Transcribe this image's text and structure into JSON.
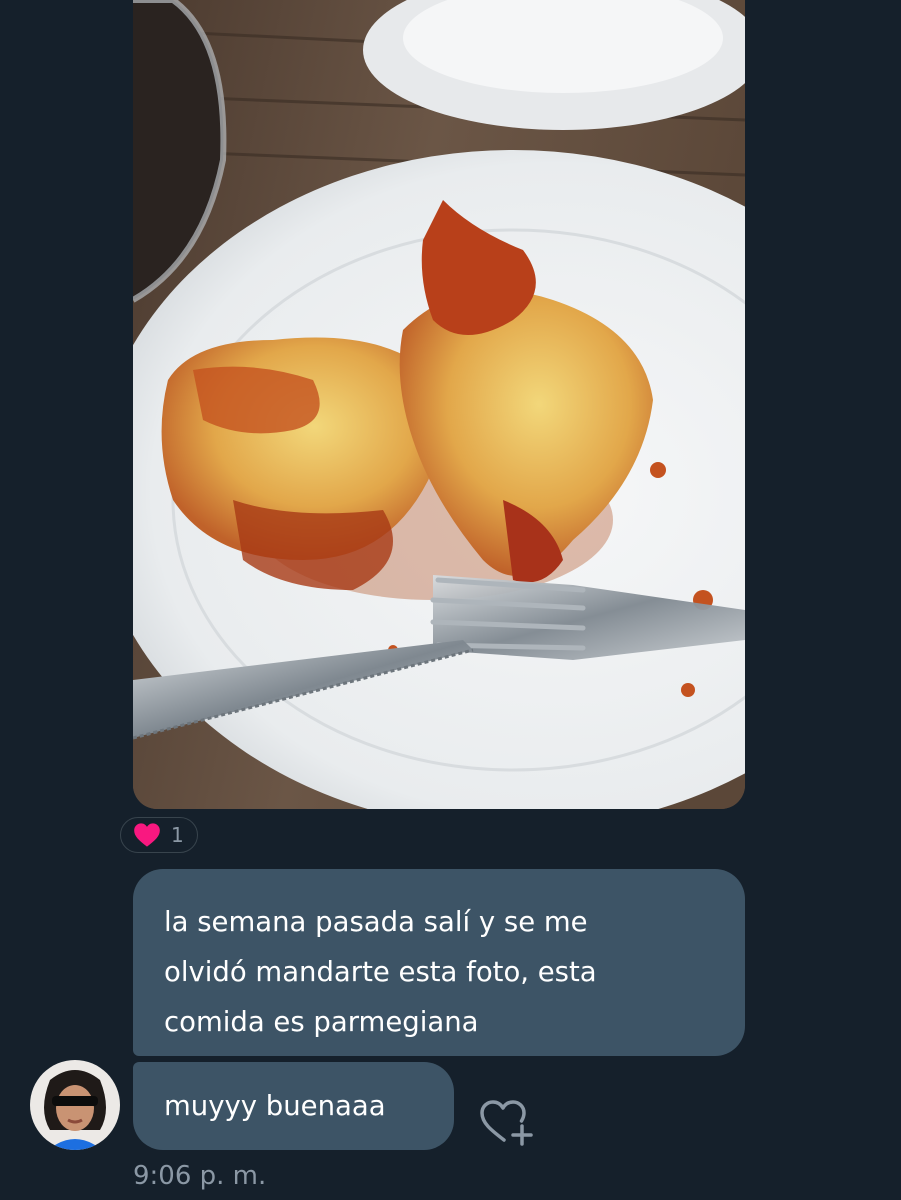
{
  "conversation": {
    "messages": [
      {
        "type": "photo",
        "reaction": {
          "icon": "heart-icon",
          "count": "1",
          "color": "#f91880"
        }
      },
      {
        "type": "text",
        "lines": [
          "la semana pasada salí y se me",
          "olvidó mandarte esta foto, esta",
          "comida es parmegiana"
        ]
      },
      {
        "type": "text",
        "text": "muyyy buenaaa",
        "react_icon": "add-reaction-icon"
      }
    ],
    "timestamp": "9:06 p. m."
  },
  "colors": {
    "background": "#15202b",
    "bubble": "#3d5466",
    "muted_text": "#8b98a5",
    "heart": "#f91880"
  }
}
